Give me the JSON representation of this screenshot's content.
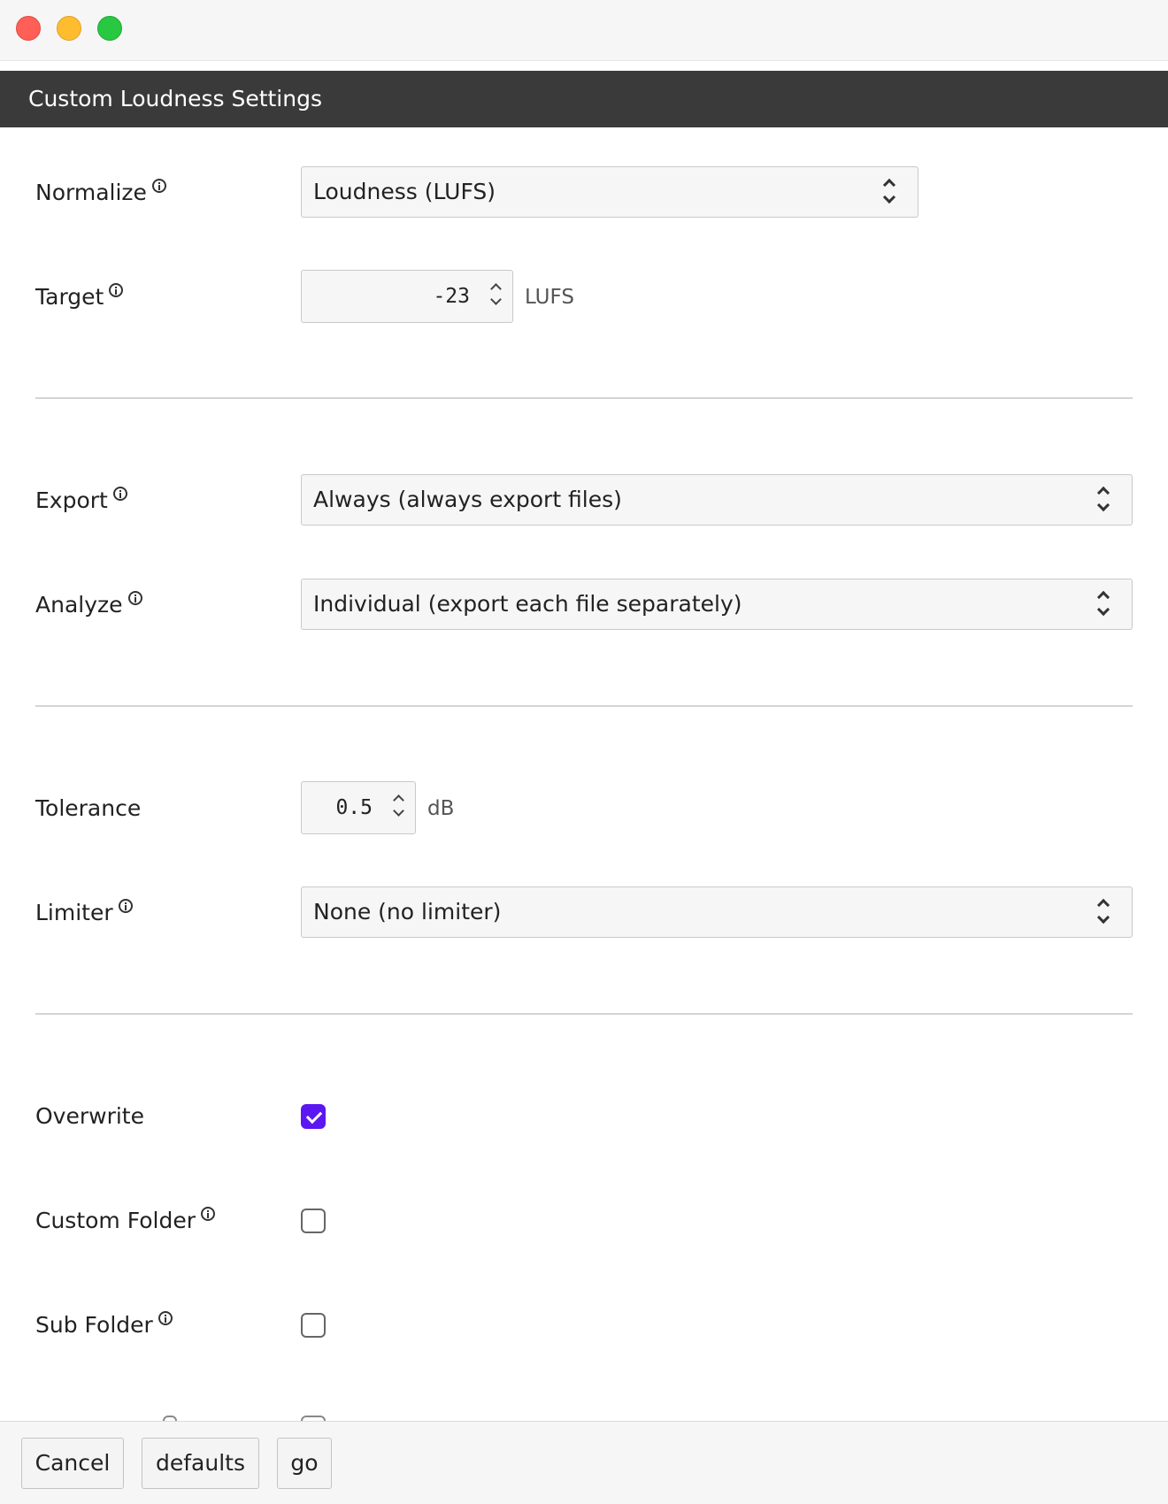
{
  "window": {
    "title": "Custom Loudness Settings"
  },
  "settings": {
    "normalize": {
      "label": "Normalize",
      "value": "Loudness (LUFS)"
    },
    "target": {
      "label": "Target",
      "value": "-23",
      "unit": "LUFS"
    },
    "export": {
      "label": "Export",
      "value": "Always (always export files)"
    },
    "analyze": {
      "label": "Analyze",
      "value": "Individual (export each file separately)"
    },
    "tolerance": {
      "label": "Tolerance",
      "value": "0.5",
      "unit": "dB"
    },
    "limiter": {
      "label": "Limiter",
      "value": "None (no limiter)"
    },
    "overwrite": {
      "label": "Overwrite",
      "checked": true
    },
    "custom_folder": {
      "label": "Custom Folder",
      "checked": false
    },
    "sub_folder": {
      "label": "Sub Folder",
      "checked": false
    }
  },
  "footer": {
    "cancel_label": "Cancel",
    "defaults_label": "defaults",
    "go_label": "go"
  },
  "colors": {
    "header_bg": "#3a3a3a",
    "checkbox_accent": "#5b17f2",
    "close": "#fe5f57",
    "minimize": "#febc2e",
    "zoom": "#28c840"
  }
}
